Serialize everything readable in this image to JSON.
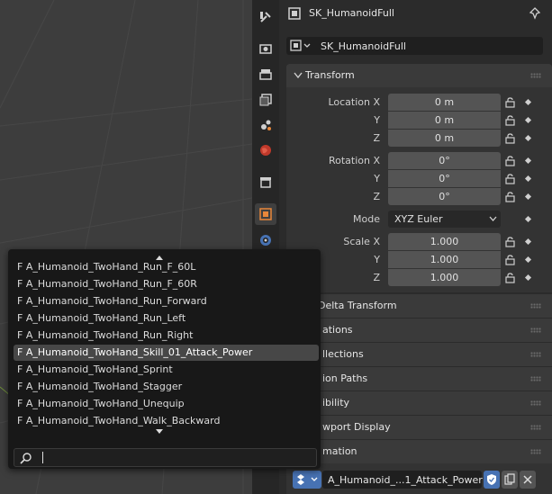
{
  "header": {
    "object_name": "SK_HumanoidFull",
    "data_name": "SK_HumanoidFull"
  },
  "transform": {
    "title": "Transform",
    "location_label": "Location X",
    "loc_y_label": "Y",
    "loc_z_label": "Z",
    "location": [
      "0 m",
      "0 m",
      "0 m"
    ],
    "rotation_label": "Rotation X",
    "rot_y_label": "Y",
    "rot_z_label": "Z",
    "rotation": [
      "0°",
      "0°",
      "0°"
    ],
    "mode_label": "Mode",
    "mode_value": "XYZ Euler",
    "scale_label": "Scale X",
    "scale_y_label": "Y",
    "scale_z_label": "Z",
    "scale": [
      "1.000",
      "1.000",
      "1.000"
    ]
  },
  "panels": {
    "delta_transform": "Delta Transform",
    "relations": "ations",
    "collections": "llections",
    "motion_paths": "ion Paths",
    "visibility": "ibility",
    "viewport_display": "wport Display",
    "animation": "mation"
  },
  "dropdown": {
    "items": [
      "F A_Humanoid_TwoHand_Run_F_60L",
      "F A_Humanoid_TwoHand_Run_F_60R",
      "F A_Humanoid_TwoHand_Run_Forward",
      "F A_Humanoid_TwoHand_Run_Left",
      "F A_Humanoid_TwoHand_Run_Right",
      "F A_Humanoid_TwoHand_Skill_01_Attack_Power",
      "F A_Humanoid_TwoHand_Sprint",
      "F A_Humanoid_TwoHand_Stagger",
      "F A_Humanoid_TwoHand_Unequip",
      "F A_Humanoid_TwoHand_Walk_Backward"
    ],
    "search_value": ""
  },
  "action": {
    "name": "A_Humanoid_...1_Attack_Power"
  },
  "colors": {
    "accent": "#4772b3",
    "selected": "#474747",
    "object_orange": "#e8873a"
  },
  "icons": [
    "tool-icon",
    "render-icon",
    "output-icon",
    "view-layer-icon",
    "scene-icon",
    "world-icon",
    "collection-icon",
    "object-icon",
    "physics-icon",
    "pin-icon",
    "lock-icon",
    "search-icon",
    "shield-icon",
    "copy-icon",
    "close-icon"
  ]
}
